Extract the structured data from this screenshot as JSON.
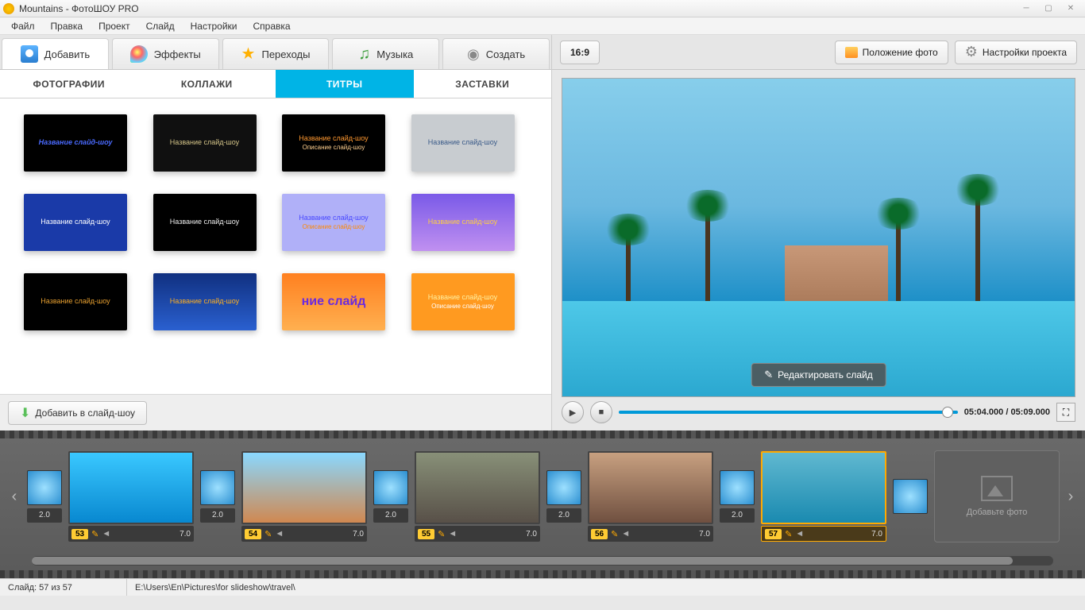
{
  "window": {
    "title": "Mountains - ФотоШОУ PRO"
  },
  "menu": [
    "Файл",
    "Правка",
    "Проект",
    "Слайд",
    "Настройки",
    "Справка"
  ],
  "top_tabs": {
    "add": "Добавить",
    "effects": "Эффекты",
    "transitions": "Переходы",
    "music": "Музыка",
    "create": "Создать",
    "active": "add"
  },
  "sub_tabs": {
    "photos": "ФОТОГРАФИИ",
    "collages": "КОЛЛАЖИ",
    "titles": "ТИТРЫ",
    "intros": "ЗАСТАВКИ",
    "active": "titles"
  },
  "templates": [
    {
      "bg": "#000000",
      "t1": "Название слайд-шоу",
      "c1": "#4a6aff",
      "style": "italic bold"
    },
    {
      "bg": "#101010",
      "t1": "Название слайд-шоу",
      "c1": "#d4c488"
    },
    {
      "bg": "#000000",
      "t1": "Название слайд-шоу",
      "t2": "Описание слайд-шоу",
      "c1": "#ff9830",
      "c2": "#ffd090"
    },
    {
      "bg": "#c8ccd0",
      "t1": "Название слайд-шоу",
      "c1": "#3a5a88"
    },
    {
      "bg": "#1a3aa8",
      "t1": "Название слайд-шоу",
      "c1": "#ffffff"
    },
    {
      "bg": "#000000",
      "t1": "Название слайд-шоу",
      "c1": "#eeeeee"
    },
    {
      "bg": "#b0b0f8",
      "t1": "Название слайд-шоу",
      "t2": "Описание слайд-шоу",
      "c1": "#4848ff",
      "c2": "#ff8800"
    },
    {
      "bg": "linear-gradient(#7a5ae8,#c090f0)",
      "t1": "Название слайд-шоу",
      "c1": "#ffd040"
    },
    {
      "bg": "#000000",
      "t1": "Название слайд-шоу",
      "c1": "#e8a030"
    },
    {
      "bg": "linear-gradient(#103080,#2a60d0)",
      "t1": "Название слайд-шоу",
      "c1": "#ffb020"
    },
    {
      "bg": "linear-gradient(#ff8020,#ffb050)",
      "t1": "ние слайд",
      "c1": "#6a2ae0",
      "style": "bold large"
    },
    {
      "bg": "#ff9a20",
      "t1": "Название слайд-шоу",
      "t2": "Описание слайд-шоу",
      "c1": "#fff0a0",
      "c2": "#ffffff"
    }
  ],
  "add_to_slideshow": "Добавить в слайд-шоу",
  "preview": {
    "aspect": "16:9",
    "photo_position": "Положение фото",
    "project_settings": "Настройки проекта",
    "edit_slide": "Редактировать слайд",
    "time": "05:04.000 / 05:09.000"
  },
  "timeline": {
    "trans_duration": "2.0",
    "slide_duration": "7.0",
    "add_photo": "Добавьте фото",
    "slides": [
      {
        "n": "53",
        "bg": "linear-gradient(180deg,#3ac8ff,#0888d0)"
      },
      {
        "n": "54",
        "bg": "linear-gradient(180deg,#8ad8ff,#d08850)"
      },
      {
        "n": "55",
        "bg": "linear-gradient(180deg,#889078,#585048)"
      },
      {
        "n": "56",
        "bg": "linear-gradient(180deg,#c8a080,#705040)"
      },
      {
        "n": "57",
        "bg": "linear-gradient(180deg,#60b8d0,#1a8ab0)",
        "selected": true
      }
    ]
  },
  "status": {
    "slide_counter": "Слайд: 57 из 57",
    "path": "E:\\Users\\En\\Pictures\\for slideshow\\travel\\"
  }
}
